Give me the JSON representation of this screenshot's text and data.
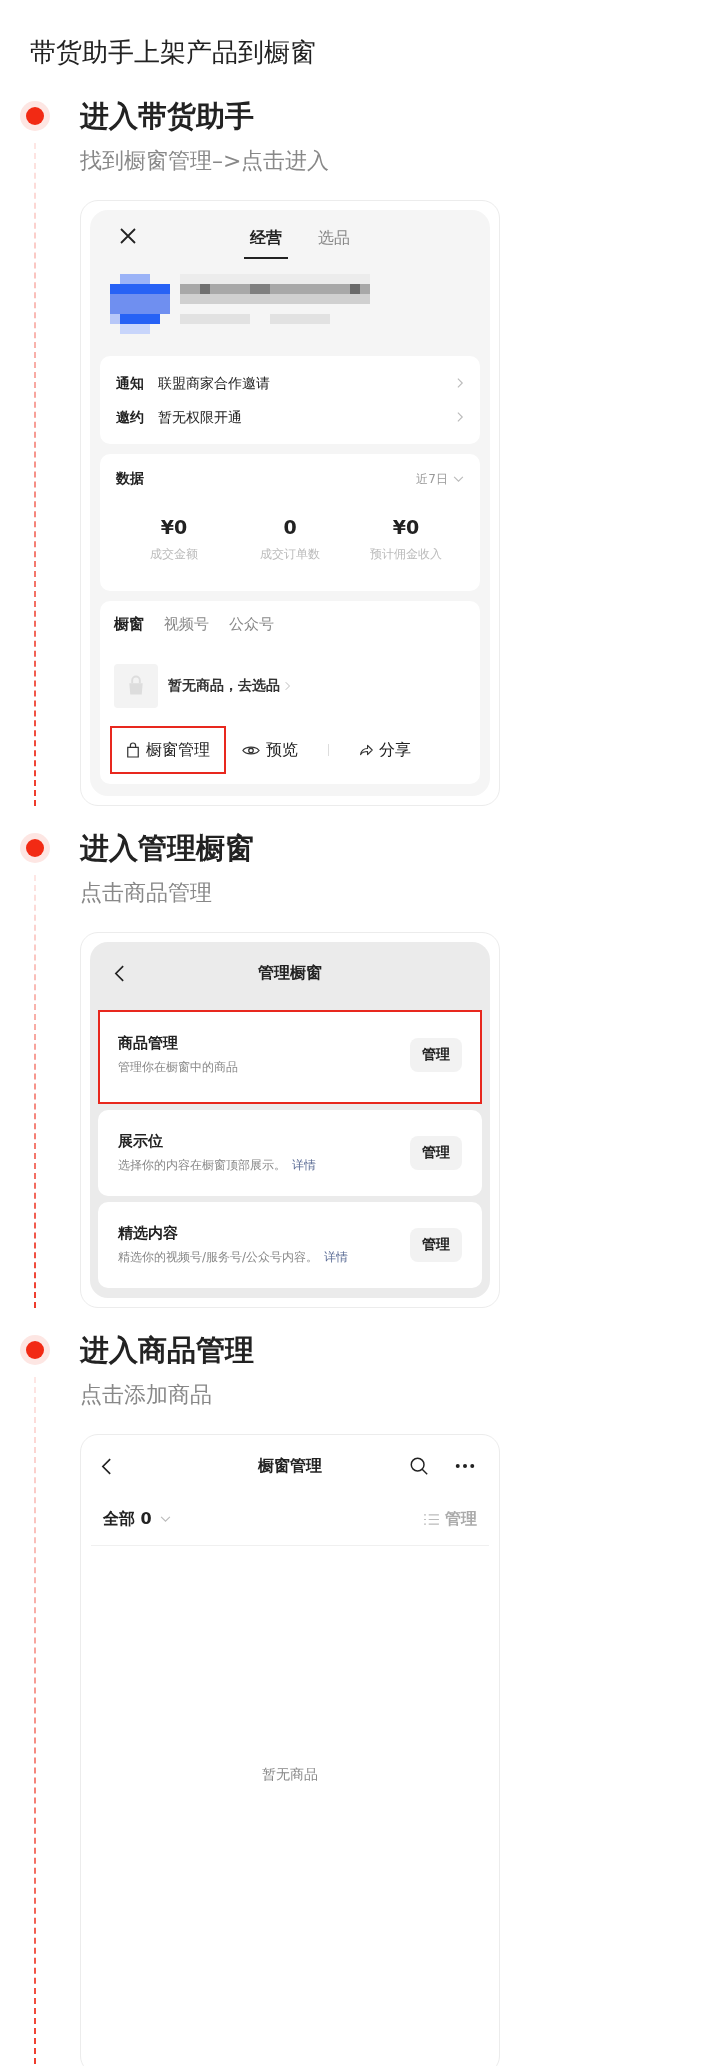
{
  "title": "带货助手上架产品到橱窗",
  "steps": [
    {
      "heading": "进入带货助手",
      "subtitle": "找到橱窗管理–>点击进入",
      "screen": {
        "kind": "assistant",
        "tabs": [
          {
            "label": "经营",
            "selected": true
          },
          {
            "label": "选品",
            "selected": false
          }
        ],
        "notices": [
          {
            "label": "通知",
            "text": "联盟商家合作邀请"
          },
          {
            "label": "邀约",
            "text": "暂无权限开通"
          }
        ],
        "data": {
          "title": "数据",
          "period": "近7日",
          "stats": [
            {
              "value": "¥0",
              "label": "成交金额"
            },
            {
              "value": "0",
              "label": "成交订单数"
            },
            {
              "value": "¥0",
              "label": "预计佣金收入"
            }
          ]
        },
        "showcase_tabs": [
          {
            "label": "橱窗",
            "selected": true
          },
          {
            "label": "视频号",
            "selected": false
          },
          {
            "label": "公众号",
            "selected": false
          }
        ],
        "empty_text": "暂无商品，去选品",
        "actions": [
          {
            "kind": "bag",
            "label": "橱窗管理",
            "highlighted": true
          },
          {
            "kind": "eye",
            "label": "预览",
            "highlighted": false
          },
          {
            "kind": "share",
            "label": "分享",
            "highlighted": false
          }
        ]
      }
    },
    {
      "heading": "进入管理橱窗",
      "subtitle": "点击商品管理",
      "screen": {
        "kind": "manage",
        "title": "管理橱窗",
        "rows": [
          {
            "title": "商品管理",
            "desc": "管理你在橱窗中的商品",
            "button": "管理",
            "highlighted": true
          },
          {
            "title": "展示位",
            "desc": "选择你的内容在橱窗顶部展示。",
            "link": "详情",
            "button": "管理",
            "highlighted": false
          },
          {
            "title": "精选内容",
            "desc": "精选你的视频号/服务号/公众号内容。",
            "link": "详情",
            "button": "管理",
            "highlighted": false
          }
        ]
      }
    },
    {
      "heading": "进入商品管理",
      "subtitle": "点击添加商品",
      "screen": {
        "kind": "products",
        "title": "橱窗管理",
        "filter": "全部 0",
        "manage": "管理",
        "empty_text": "暂无商品"
      }
    }
  ]
}
